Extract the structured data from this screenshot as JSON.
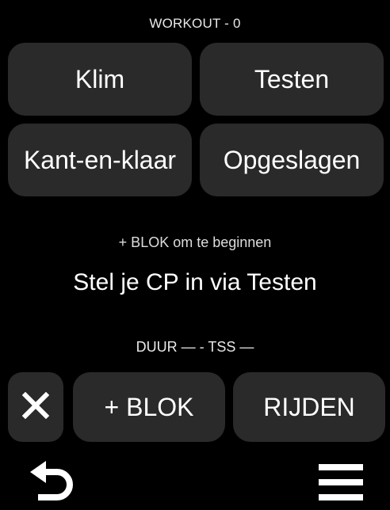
{
  "header": {
    "title": "WORKOUT - 0"
  },
  "grid": {
    "climb_label": "Klim",
    "test_label": "Testen",
    "ready_made_label": "Kant-en-klaar",
    "saved_label": "Opgeslagen"
  },
  "main": {
    "hint": "+ BLOK om te beginnen",
    "cp_message": "Stel je CP in via Testen",
    "stats": "DUUR — - TSS —"
  },
  "actions": {
    "add_block_label": "+ BLOK",
    "ride_label": "RIJDEN",
    "close_icon": "close-icon"
  },
  "bottom": {
    "back_icon": "back-arrow-icon",
    "menu_icon": "menu-icon"
  },
  "colors": {
    "background": "#000000",
    "button": "#2a2a2a",
    "text": "#ffffff"
  }
}
